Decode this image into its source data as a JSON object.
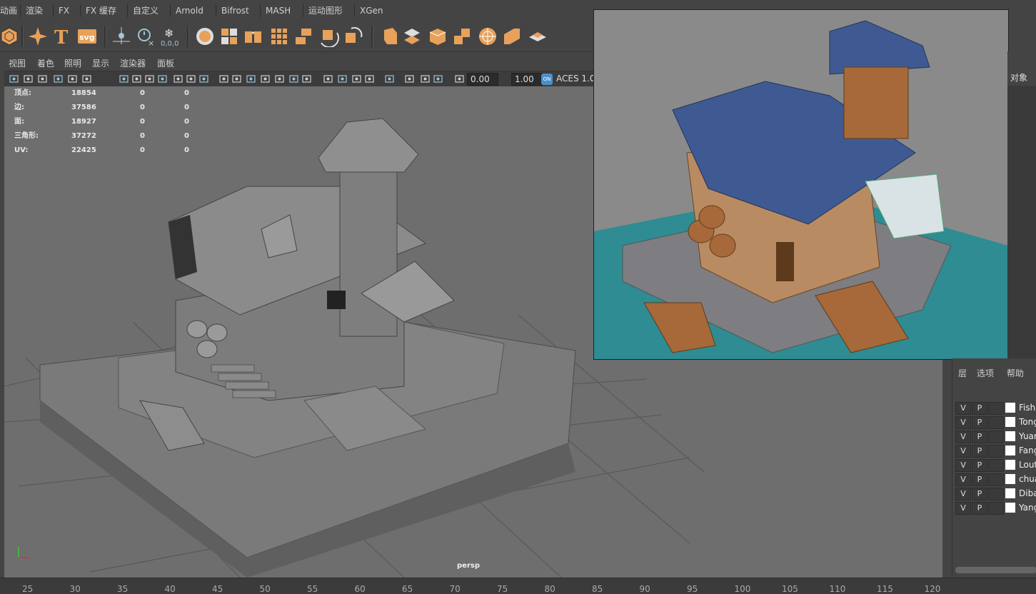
{
  "menubar": {
    "items": [
      "动画",
      "渲染",
      "FX",
      "FX 缓存",
      "自定义",
      "Arnold",
      "Bifrost",
      "MASH",
      "运动图形",
      "XGen"
    ]
  },
  "shelf": {
    "icons": [
      "poly-sphere-icon",
      "sparkle-icon",
      "text-icon",
      "svg-icon",
      "locator-icon",
      "stopwatch-icon",
      "snowflake-icon",
      "plane-icon",
      "cube-bevel-icon",
      "extrude-icon",
      "grid-icon",
      "bridge-icon",
      "rotate-icon",
      "boolean-icon",
      "split-icon",
      "slice-icon",
      "soccer-ball-icon",
      "combine-icon",
      "fold-icon",
      "uv-icon",
      "box-icon"
    ],
    "coordinate_label": "0,0,0",
    "svg_label": "svg"
  },
  "viewport_menu": [
    "视图",
    "着色",
    "照明",
    "显示",
    "渲染器",
    "面板"
  ],
  "viewport_toolbar": {
    "exposure": "0.00",
    "gamma": "1.00",
    "color_space": "ACES 1.0"
  },
  "hud": [
    {
      "label": "顶点:",
      "a": "18854",
      "b": "0",
      "c": "0"
    },
    {
      "label": "边:",
      "a": "37586",
      "b": "0",
      "c": "0"
    },
    {
      "label": "面:",
      "a": "18927",
      "b": "0",
      "c": "0"
    },
    {
      "label": "三角形:",
      "a": "37272",
      "b": "0",
      "c": "0"
    },
    {
      "label": "UV:",
      "a": "22425",
      "b": "0",
      "c": "0"
    }
  ],
  "camera_label": "persp",
  "right_panel_label": "对象",
  "layer_panel": {
    "menu": [
      "层",
      "选项",
      "帮助"
    ],
    "layers": [
      {
        "v": "V",
        "p": "P",
        "name": "Fish"
      },
      {
        "v": "V",
        "p": "P",
        "name": "Tong"
      },
      {
        "v": "V",
        "p": "P",
        "name": "Yuan"
      },
      {
        "v": "V",
        "p": "P",
        "name": "Fang"
      },
      {
        "v": "V",
        "p": "P",
        "name": "Lout"
      },
      {
        "v": "V",
        "p": "P",
        "name": "chua"
      },
      {
        "v": "V",
        "p": "P",
        "name": "Diba"
      },
      {
        "v": "V",
        "p": "P",
        "name": "Yang"
      }
    ]
  },
  "timeline_ticks": [
    "25",
    "30",
    "35",
    "40",
    "45",
    "50",
    "55",
    "60",
    "65",
    "70",
    "75",
    "80",
    "85",
    "90",
    "95",
    "100",
    "105",
    "110",
    "115",
    "120"
  ],
  "colors": {
    "shelf_accent": "#e8a15a",
    "viewport_bg": "#6e6e6e",
    "ui_bg": "#444444",
    "water": "#2e8c92",
    "roof": "#3f5a92",
    "wood": "#a7693a"
  }
}
